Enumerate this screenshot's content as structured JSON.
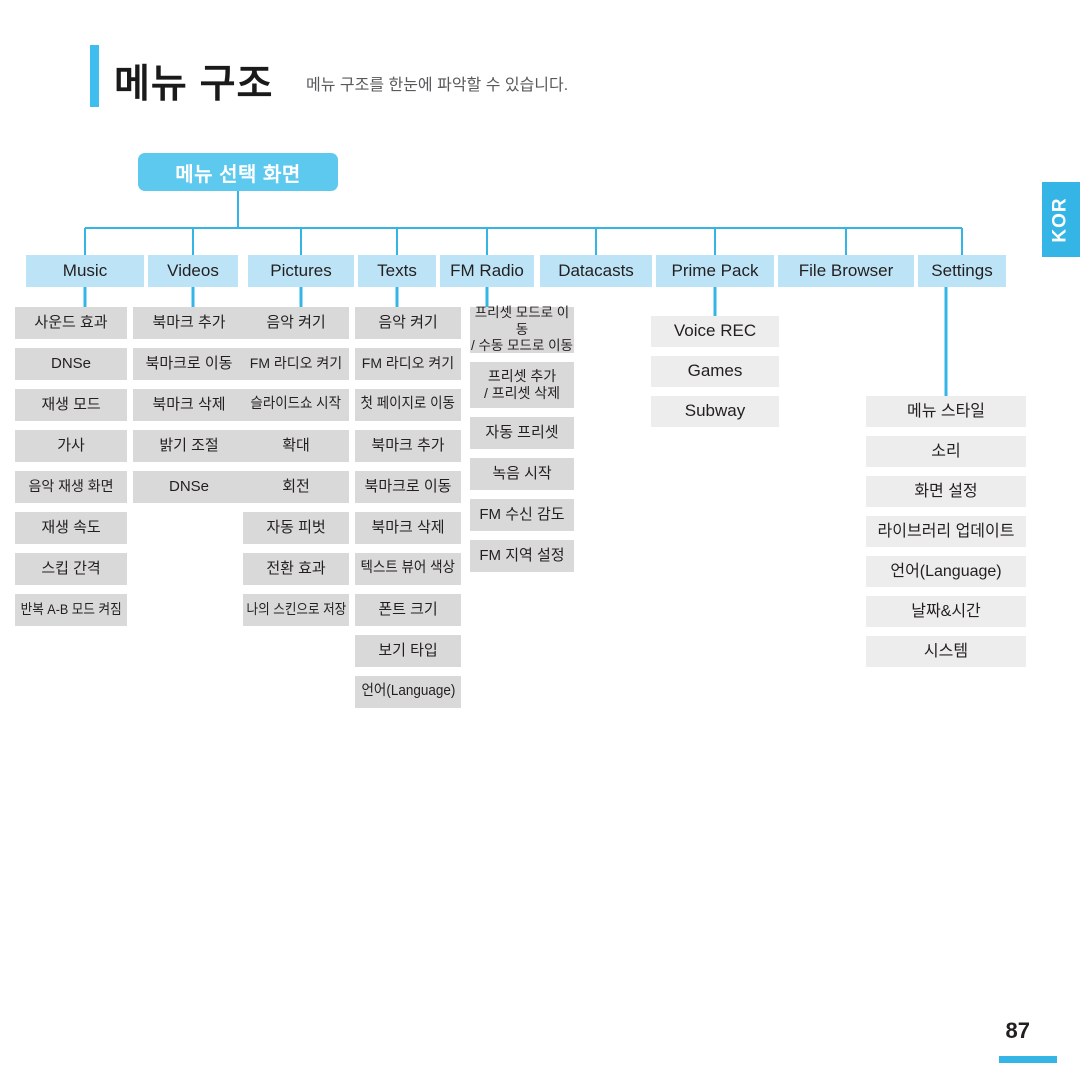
{
  "header": {
    "title": "메뉴 구조",
    "subtitle": "메뉴 구조를 한눈에 파악할 수 있습니다."
  },
  "side_tab": {
    "label": "KOR"
  },
  "footer": {
    "page_number": "87"
  },
  "colors": {
    "accent": "#35b5e5",
    "root_node": "#5ec9ee",
    "category_box": "#bde4f6",
    "child_box": "#d9d9d9",
    "connector": "#35b5e5",
    "text": "#231f20"
  },
  "tree": {
    "root": {
      "label": "메뉴 선택 화면"
    },
    "categories": [
      {
        "label": "Music",
        "children": [
          "사운드 효과",
          "DNSe",
          "재생 모드",
          "가사",
          "음악 재생 화면",
          "재생 속도",
          "스킵 간격",
          "반복 A-B 모드 켜짐"
        ]
      },
      {
        "label": "Videos",
        "children": [
          "북마크 추가",
          "북마크로 이동",
          "북마크 삭제",
          "밝기 조절",
          "DNSe"
        ]
      },
      {
        "label": "Pictures",
        "children": [
          "음악 켜기",
          "FM 라디오 켜기",
          "슬라이드쇼 시작",
          "확대",
          "회전",
          "자동 피벗",
          "전환 효과",
          "나의 스킨으로 저장"
        ]
      },
      {
        "label": "Texts",
        "children": [
          "음악 켜기",
          "FM 라디오 켜기",
          "첫 페이지로 이동",
          "북마크 추가",
          "북마크로 이동",
          "북마크 삭제",
          "텍스트 뷰어 색상",
          "폰트 크기",
          "보기 타입",
          "언어(Language)"
        ]
      },
      {
        "label": "FM Radio",
        "children": [
          "프리셋 모드로 이동\n/ 수동 모드로 이동",
          "프리셋 추가\n/ 프리셋 삭제",
          "자동 프리셋",
          "녹음 시작",
          "FM 수신 감도",
          "FM 지역 설정"
        ]
      },
      {
        "label": "Datacasts",
        "children": []
      },
      {
        "label": "Prime Pack",
        "children": [
          "Voice REC",
          "Games",
          "Subway"
        ]
      },
      {
        "label": "File Browser",
        "children": []
      },
      {
        "label": "Settings",
        "children": [
          "메뉴 스타일",
          "소리",
          "화면 설정",
          "라이브러리 업데이트",
          "언어(Language)",
          "날짜&시간",
          "시스템"
        ]
      }
    ]
  }
}
